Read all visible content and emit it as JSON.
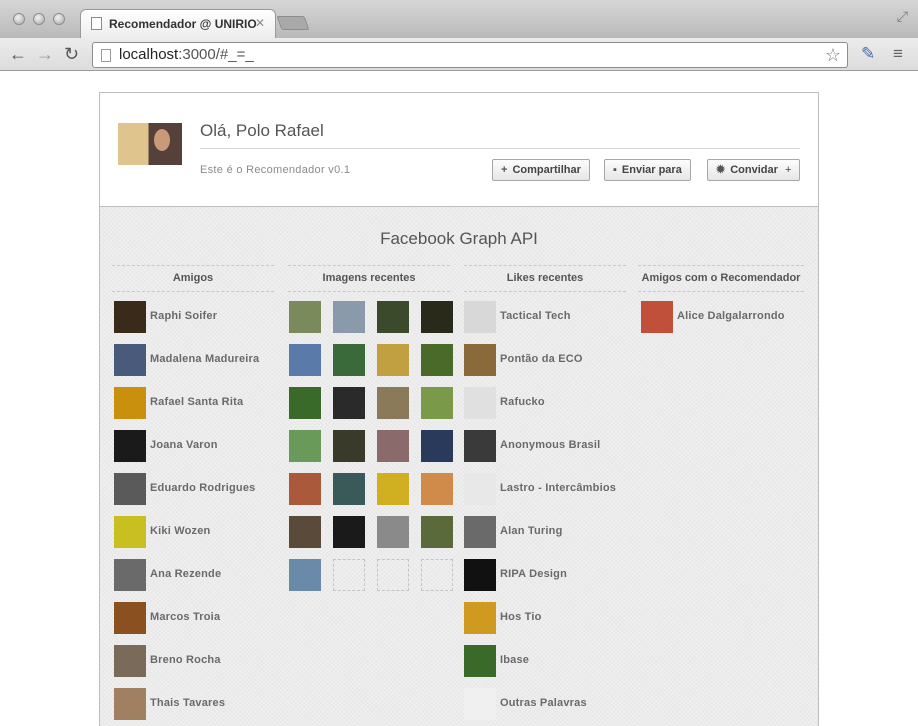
{
  "browser": {
    "tab_title": "Recomendador @ UNIRIO",
    "url_host": "localhost",
    "url_rest": ":3000/#_=_"
  },
  "header": {
    "greeting": "Olá, Polo Rafael",
    "version": "Este é o Recomendador v0.1",
    "buttons": {
      "share": "Compartilhar",
      "send": "Enviar para",
      "invite": "Convidar"
    },
    "invite_suffix": "+"
  },
  "main": {
    "title": "Facebook Graph API",
    "columns": {
      "friends": "Amigos",
      "images": "Imagens recentes",
      "likes": "Likes recentes",
      "app_friends": "Amigos com o Recomendador"
    },
    "friends": [
      {
        "name": "Raphi Soifer",
        "color": "#3a2a1a"
      },
      {
        "name": "Madalena Madureira",
        "color": "#4a5a7a"
      },
      {
        "name": "Rafael Santa Rita",
        "color": "#c8900c"
      },
      {
        "name": "Joana Varon",
        "color": "#1a1a1a"
      },
      {
        "name": "Eduardo Rodrigues",
        "color": "#5a5a5a"
      },
      {
        "name": "Kiki Wozen",
        "color": "#c8c020"
      },
      {
        "name": "Ana Rezende",
        "color": "#6a6a6a"
      },
      {
        "name": "Marcos Troia",
        "color": "#8a5020"
      },
      {
        "name": "Breno Rocha",
        "color": "#7a6a5a"
      },
      {
        "name": "Thais Tavares",
        "color": "#a08060"
      }
    ],
    "images": [
      [
        "#7a8a5a",
        "#8a9aaa",
        "#3a4a2a",
        "#2a2a1a"
      ],
      [
        "#5a7aaa",
        "#3a6a3a",
        "#c0a040",
        "#4a6a2a"
      ],
      [
        "#3a6a2a",
        "#2a2a2a",
        "#8a7a5a",
        "#7a9a4a"
      ],
      [
        "#6a9a5a",
        "#3a3a2a",
        "#8a6a6a",
        "#2a3a5a"
      ],
      [
        "#aa5a3a",
        "#3a5a5a",
        "#d0b020",
        "#d08a4a"
      ],
      [
        "#5a4a3a",
        "#1a1a1a",
        "#8a8a8a",
        "#5a6a3a"
      ],
      [
        "#6a8aaa",
        "",
        "",
        ""
      ]
    ],
    "likes": [
      {
        "name": "Tactical Tech",
        "color": "#d8d8d8"
      },
      {
        "name": "Pontão da ECO",
        "color": "#8a6a3a"
      },
      {
        "name": "Rafucko",
        "color": "#e0e0e0"
      },
      {
        "name": "Anonymous Brasil",
        "color": "#3a3a3a"
      },
      {
        "name": "Lastro - Intercâmbios",
        "color": "#e8e8e8"
      },
      {
        "name": "Alan Turing",
        "color": "#6a6a6a"
      },
      {
        "name": "RIPA Design",
        "color": "#111111"
      },
      {
        "name": "Hos Tio",
        "color": "#d09a20"
      },
      {
        "name": "Ibase",
        "color": "#3a6a2a"
      },
      {
        "name": "Outras Palavras",
        "color": "#f0f0f0"
      }
    ],
    "app_friends": [
      {
        "name": "Alice Dalgalarrondo",
        "color": "#c0503a"
      }
    ]
  }
}
